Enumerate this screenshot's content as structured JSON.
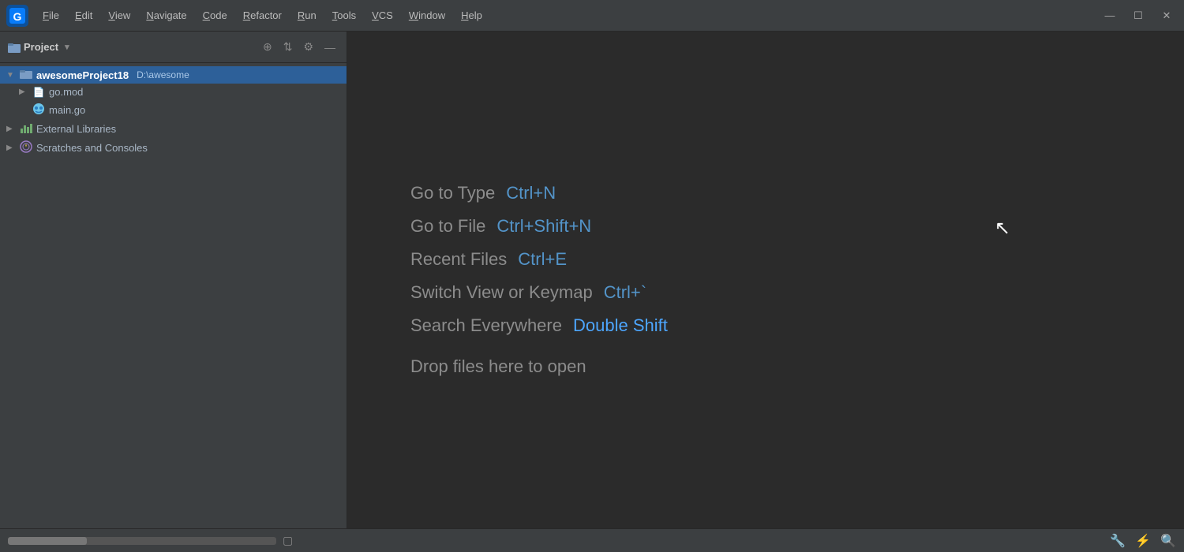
{
  "titlebar": {
    "logo_alt": "GoLand logo",
    "menu_items": [
      {
        "id": "file",
        "label": "File",
        "underline": "F"
      },
      {
        "id": "edit",
        "label": "Edit",
        "underline": "E"
      },
      {
        "id": "view",
        "label": "View",
        "underline": "V"
      },
      {
        "id": "navigate",
        "label": "Navigate",
        "underline": "N"
      },
      {
        "id": "code",
        "label": "Code",
        "underline": "C"
      },
      {
        "id": "refactor",
        "label": "Refactor",
        "underline": "R"
      },
      {
        "id": "run",
        "label": "Run",
        "underline": "R"
      },
      {
        "id": "tools",
        "label": "Tools",
        "underline": "T"
      },
      {
        "id": "vcs",
        "label": "VCS",
        "underline": "V"
      },
      {
        "id": "window",
        "label": "Window",
        "underline": "W"
      },
      {
        "id": "help",
        "label": "Help",
        "underline": "H"
      }
    ],
    "controls": {
      "minimize": "—",
      "maximize": "☐",
      "close": "✕"
    }
  },
  "sidebar": {
    "title": "Project",
    "icons": {
      "add": "⊕",
      "collapse": "⇅",
      "gear": "⚙",
      "minus": "—"
    },
    "tree": {
      "root": {
        "name": "awesomeProject18",
        "path": "D:\\awesome",
        "expanded": true
      },
      "items": [
        {
          "id": "go-mod",
          "label": "go.mod",
          "icon": "📄",
          "indent": 1,
          "expanded": false
        },
        {
          "id": "main-go",
          "label": "main.go",
          "icon": "🐭",
          "indent": 1
        },
        {
          "id": "ext-libs",
          "label": "External Libraries",
          "icon": "📊",
          "indent": 0,
          "expanded": false
        },
        {
          "id": "scratches",
          "label": "Scratches and Consoles",
          "icon": "⏰",
          "indent": 0
        }
      ]
    }
  },
  "editor": {
    "shortcuts": [
      {
        "action": "Go to Type",
        "key": "Ctrl+N"
      },
      {
        "action": "Go to File",
        "key": "Ctrl+Shift+N"
      },
      {
        "action": "Recent Files",
        "key": "Ctrl+E"
      },
      {
        "action": "Switch View or Keymap",
        "key": "Ctrl+`"
      },
      {
        "action": "Search Everywhere",
        "key": "Double Shift",
        "key_highlight": true
      }
    ],
    "drop_text": "Drop files here to open"
  },
  "statusbar": {
    "right_icons": [
      "🔧",
      "⚡",
      "🔍"
    ]
  }
}
